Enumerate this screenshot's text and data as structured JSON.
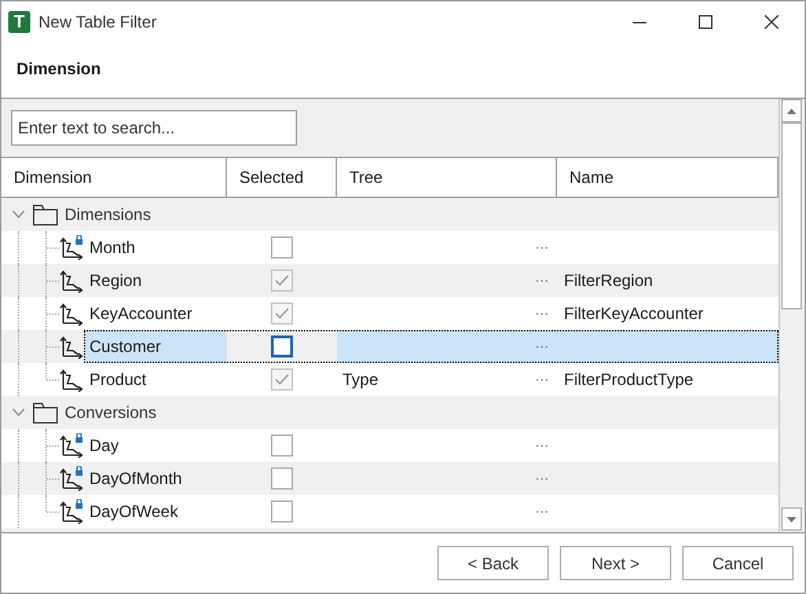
{
  "window": {
    "icon_letter": "T",
    "title": "New Table Filter"
  },
  "heading": "Dimension",
  "search": {
    "placeholder": "Enter text to search..."
  },
  "columns": [
    "Dimension",
    "Selected",
    "Tree",
    "Name"
  ],
  "groups": [
    {
      "label": "Dimensions",
      "expanded": true,
      "children": [
        {
          "label": "Month",
          "locked": true,
          "checked": false,
          "selected": false,
          "edit": "···"
        },
        {
          "label": "Region",
          "locked": false,
          "checked": true,
          "selected": false,
          "edit": "···",
          "name": "FilterRegion"
        },
        {
          "label": "KeyAccounter",
          "locked": false,
          "checked": true,
          "selected": false,
          "edit": "···",
          "name": "FilterKeyAccounter"
        },
        {
          "label": "Customer",
          "locked": false,
          "checked": false,
          "selected": true,
          "edit": "···"
        },
        {
          "label": "Product",
          "locked": false,
          "checked": true,
          "selected": false,
          "tree": "Type",
          "edit": "···",
          "name": "FilterProductType"
        }
      ]
    },
    {
      "label": "Conversions",
      "expanded": true,
      "children": [
        {
          "label": "Day",
          "locked": true,
          "checked": false,
          "selected": false,
          "edit": "···"
        },
        {
          "label": "DayOfMonth",
          "locked": true,
          "checked": false,
          "selected": false,
          "edit": "···"
        },
        {
          "label": "DayOfWeek",
          "locked": true,
          "checked": false,
          "selected": false,
          "edit": "···"
        }
      ]
    }
  ],
  "buttons": [
    "< Back",
    "Next >",
    "Cancel"
  ]
}
